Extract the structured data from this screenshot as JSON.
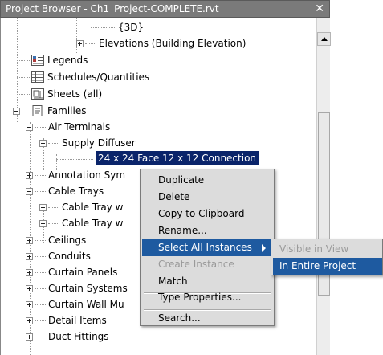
{
  "window": {
    "title": "Project Browser - Ch1_Project-COMPLETE.rvt",
    "close_glyph": "✕"
  },
  "tree": {
    "items": [
      {
        "label": "{3D}"
      },
      {
        "label": "Elevations (Building Elevation)"
      },
      {
        "label": "Legends"
      },
      {
        "label": "Schedules/Quantities"
      },
      {
        "label": "Sheets (all)"
      },
      {
        "label": "Families"
      },
      {
        "label": "Air Terminals"
      },
      {
        "label": "Supply Diffuser"
      },
      {
        "label": "24 x 24 Face 12 x 12 Connection"
      },
      {
        "label": "Annotation Sym"
      },
      {
        "label": "Cable Trays"
      },
      {
        "label": "Cable Tray w"
      },
      {
        "label": "Cable Tray w"
      },
      {
        "label": "Ceilings"
      },
      {
        "label": "Conduits"
      },
      {
        "label": "Curtain Panels"
      },
      {
        "label": "Curtain Systems"
      },
      {
        "label": "Curtain Wall Mu"
      },
      {
        "label": "Detail Items"
      },
      {
        "label": "Duct Fittings"
      }
    ]
  },
  "context_menu": {
    "items": [
      {
        "label": "Duplicate"
      },
      {
        "label": "Delete"
      },
      {
        "label": "Copy to Clipboard"
      },
      {
        "label": "Rename..."
      },
      {
        "label": "Select All Instances"
      },
      {
        "label": "Create Instance"
      },
      {
        "label": "Match"
      },
      {
        "label": "Type Properties..."
      },
      {
        "label": "Search..."
      }
    ]
  },
  "submenu": {
    "items": [
      {
        "label": "Visible in View"
      },
      {
        "label": "In Entire Project"
      }
    ]
  },
  "colors": {
    "titlebar": "#7a7a7a",
    "selection": "#0a246a",
    "menu_highlight": "#1e5aa0",
    "menu_bg": "#dcdcdc",
    "disabled_text": "#9a9a9a"
  },
  "icons": [
    "legends-icon",
    "schedules-icon",
    "sheets-icon",
    "families-icon",
    "submenu-arrow-icon",
    "close-icon",
    "scroll-up-icon"
  ]
}
